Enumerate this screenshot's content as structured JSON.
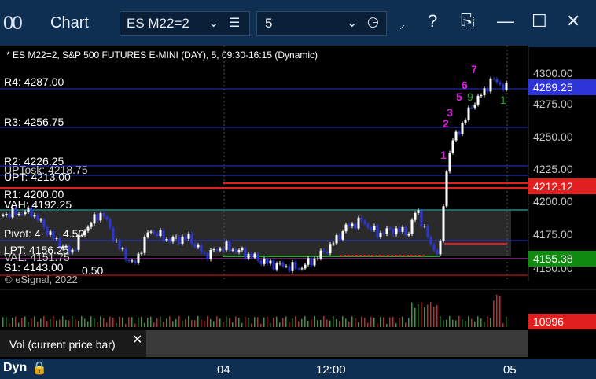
{
  "window": {
    "title": "Chart",
    "symbol": "ES M22=2",
    "interval": "5",
    "buttons": {
      "tick_icon": "tick-icon",
      "help": "?",
      "minimize": "—",
      "maximize": "☐",
      "close": "✕"
    }
  },
  "chart": {
    "header": "* ES M22=2, S&P 500 FUTURES E-MINI (DAY), 5, 09:30-16:15 (Dynamic)",
    "copyright": "© eSignal, 2022",
    "levels": {
      "r4": "R4: 4287.00",
      "r3": "R3: 4256.75",
      "r2": "R2: 4226.25",
      "upt_hidden": "UPTosk: 4218.75",
      "upt": "UPT: 4213.00",
      "r1": "R1: 4200.00",
      "vah": "VAH: 4192.25",
      "pivot": "Pivot: 4",
      "pivot_tail": "4.50",
      "lpt": "LPT: 4156.25",
      "val": "VAL: 4151.75",
      "s1": "S1: 4143.00",
      "s1_tail": "0.50"
    },
    "price_axis": [
      "4300.00",
      "4275.00",
      "4250.00",
      "4225.00",
      "4200.00",
      "4175.00",
      "4150.00"
    ],
    "tags": {
      "last": "4289.25",
      "upper": "4212.12",
      "lower": "4155.38",
      "volume": "10996"
    },
    "time_axis": [
      "04",
      "12:00",
      "05"
    ],
    "counts": {
      "magenta": [
        "1",
        "2",
        "3",
        "5",
        "6",
        "7"
      ],
      "green": [
        "9",
        "1"
      ]
    }
  },
  "volume_panel": {
    "label": "Vol (current price bar)",
    "close": "✕"
  },
  "bottom": {
    "mode": "Dyn",
    "lock_icon": "lock-icon"
  }
}
